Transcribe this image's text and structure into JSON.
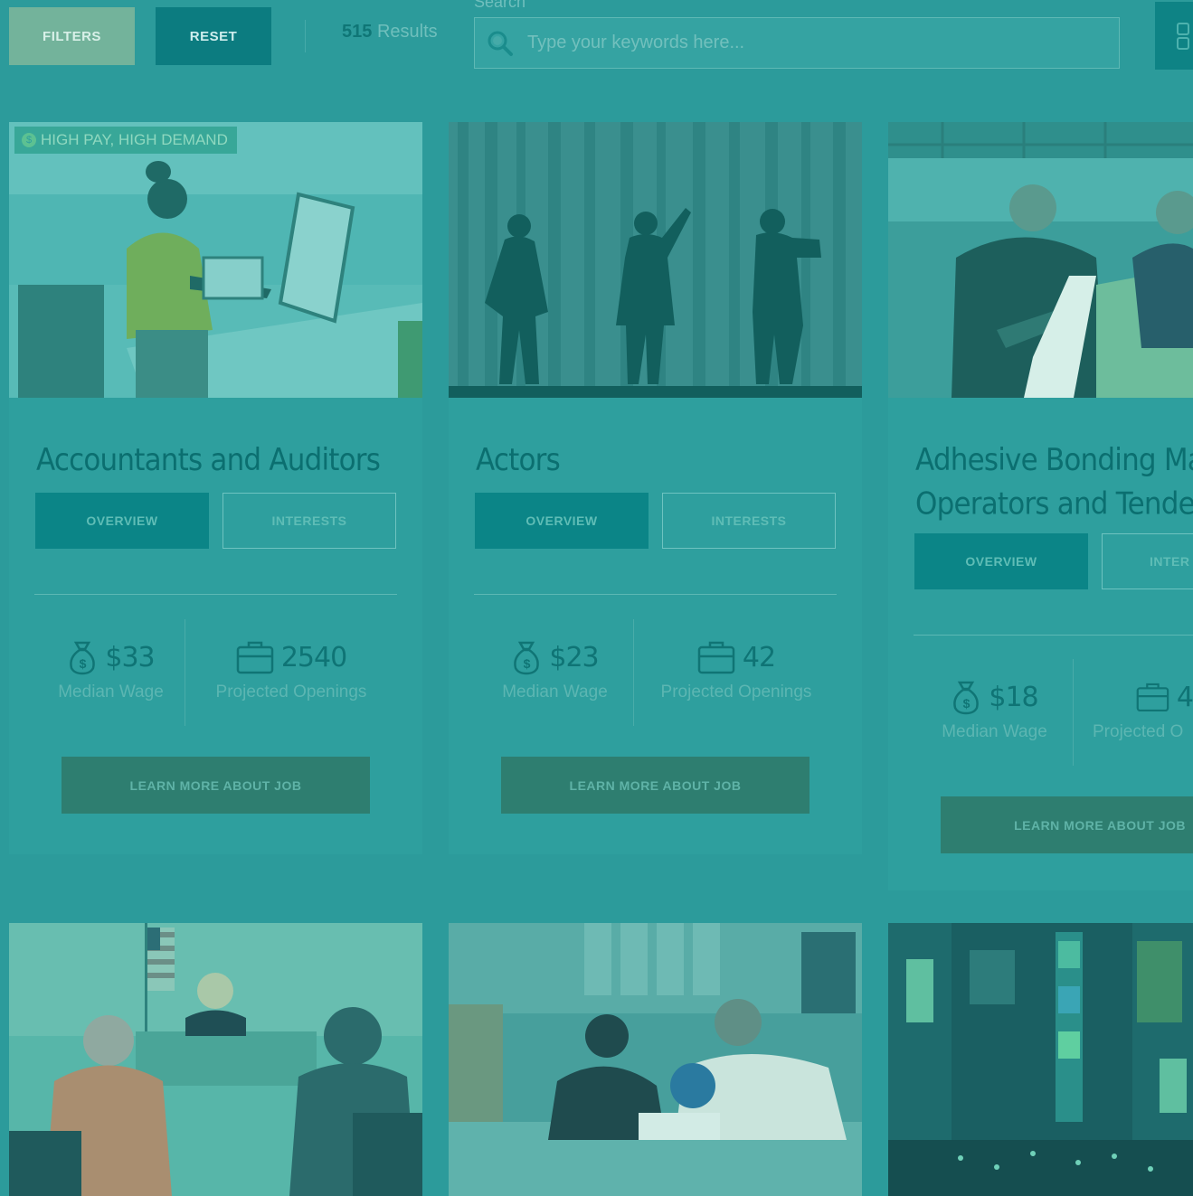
{
  "toolbar": {
    "filters_label": "FILTERS",
    "reset_label": "RESET",
    "results_count": "515",
    "results_label": "Results",
    "search_label": "Search",
    "search_placeholder": "Type your keywords here..."
  },
  "cards": [
    {
      "badge": "HIGH PAY, HIGH DEMAND",
      "title_line1": "Accountants and Auditors",
      "title_line2": "",
      "overview_label": "OVERVIEW",
      "interests_label": "INTERESTS",
      "wage": "$33",
      "wage_label": "Median Wage",
      "openings": "2540",
      "openings_label": "Projected Openings",
      "learn_label": "LEARN MORE ABOUT JOB"
    },
    {
      "badge": "",
      "title_line1": "Actors",
      "title_line2": "",
      "overview_label": "OVERVIEW",
      "interests_label": "INTERESTS",
      "wage": "$23",
      "wage_label": "Median Wage",
      "openings": "42",
      "openings_label": "Projected Openings",
      "learn_label": "LEARN MORE ABOUT JOB"
    },
    {
      "badge": "",
      "title_line1": "Adhesive Bonding Mach",
      "title_line2": "Operators and Tenders",
      "overview_label": "OVERVIEW",
      "interests_label": "INTER",
      "wage": "$18",
      "wage_label": "Median Wage",
      "openings": "4",
      "openings_label": "Projected O",
      "learn_label": "LEARN MORE ABOUT JOB"
    }
  ],
  "colors": {
    "page_bg": "#2c9b9b",
    "primary_teal": "#0b8587",
    "filters_green": "#73b39b",
    "learn_more_green": "#2e7e70"
  }
}
